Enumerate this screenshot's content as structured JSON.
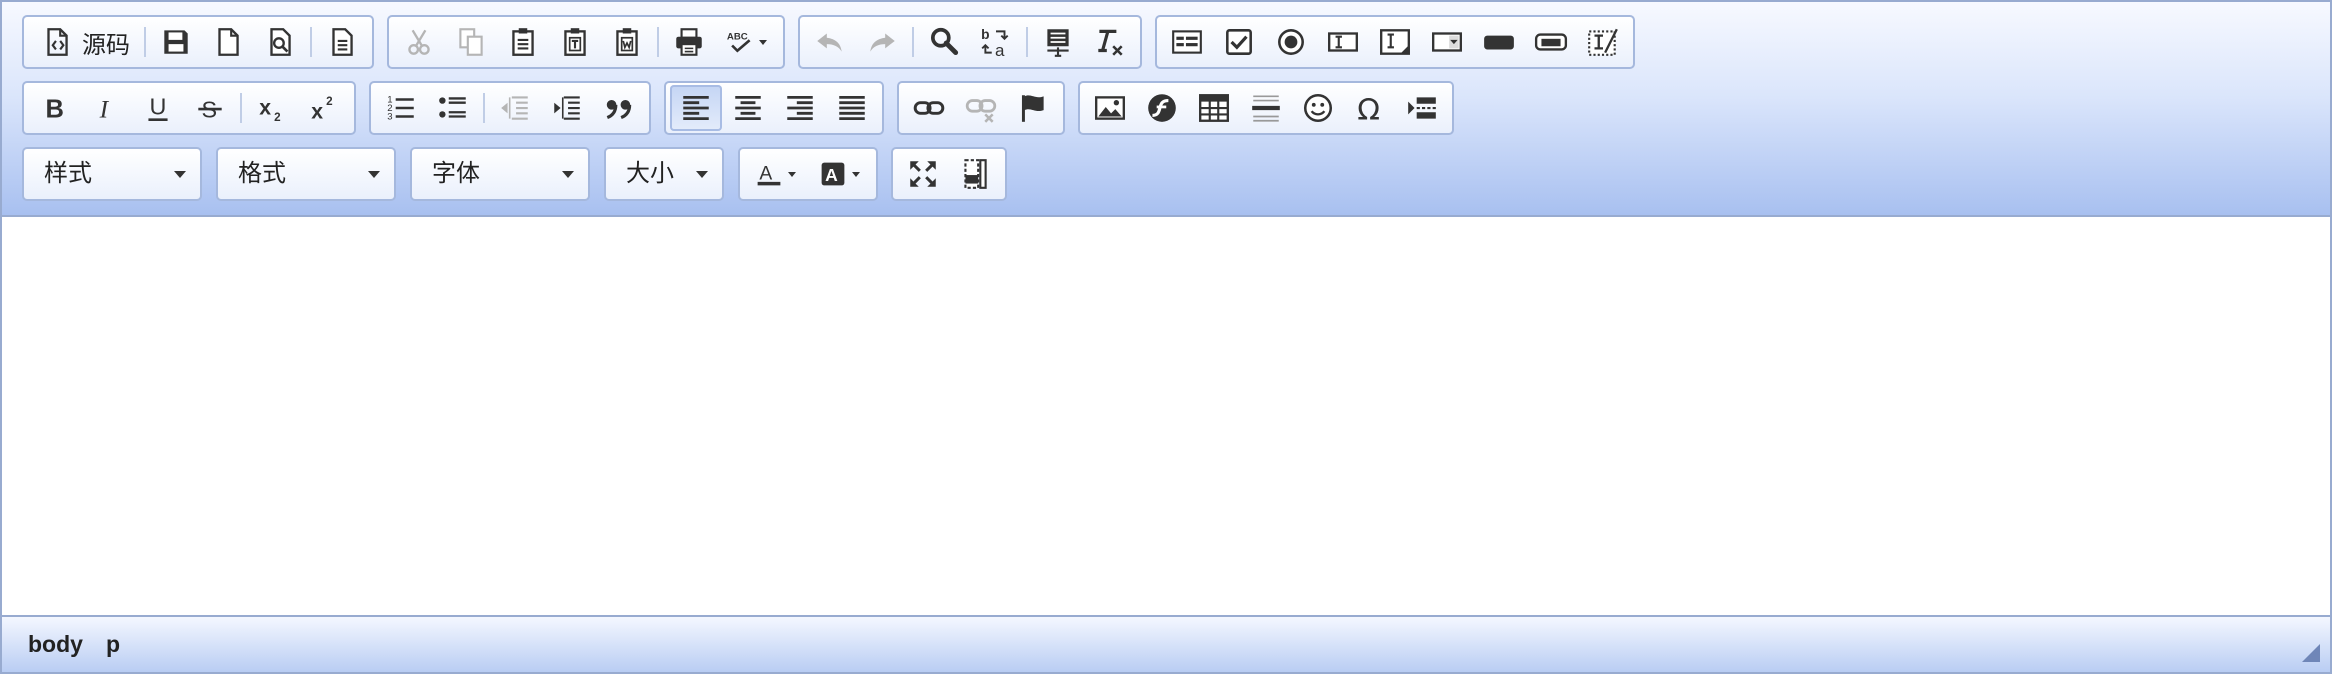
{
  "toolbar": {
    "source_label": "源码",
    "style_combo": "样式",
    "format_combo": "格式",
    "font_combo": "字体",
    "size_combo": "大小"
  },
  "statusbar": {
    "path": [
      "body",
      "p"
    ]
  },
  "colors": {
    "toolbar_top": "#f7f9ff",
    "toolbar_bottom": "#a8c0f0",
    "border": "#98abd0",
    "icon": "#333333",
    "icon_disabled": "#b5b5b5"
  }
}
